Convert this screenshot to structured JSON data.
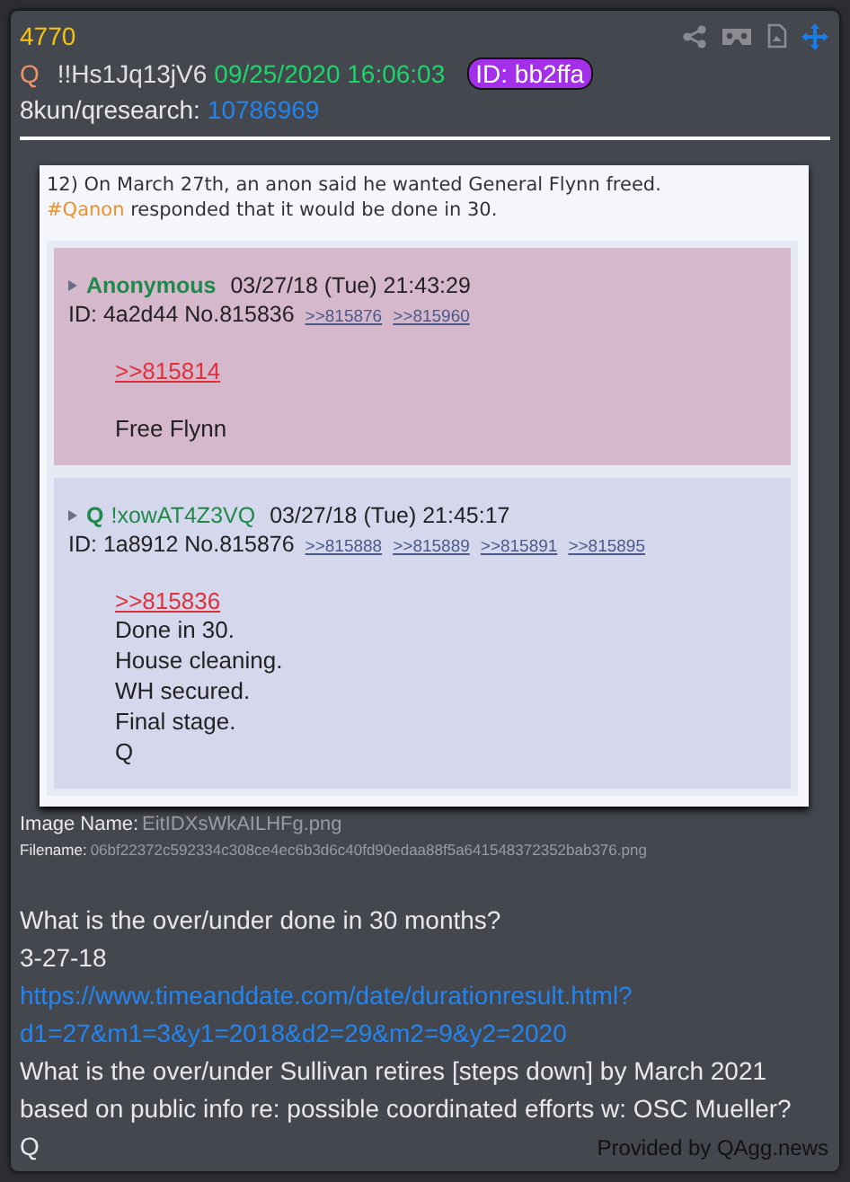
{
  "post": {
    "number": "4770",
    "author": "Q",
    "tripcode": "!!Hs1Jq13jV6",
    "timestamp": "09/25/2020 16:06:03",
    "id_badge": "ID: bb2ffa",
    "board": "8kun/qresearch:",
    "thread": "10786969"
  },
  "image": {
    "caption": "12) On March 27th, an anon said he wanted General Flynn freed.",
    "hashtag": "#Qanon",
    "caption_rest": "responded that it would be done in 30.",
    "posts": [
      {
        "name": "Anonymous",
        "date": "03/27/18 (Tue) 21:43:29",
        "id_line": "ID: 4a2d44 No.815836",
        "replies": [
          ">>815876",
          ">>815960"
        ],
        "quote": ">>815814",
        "kind": "spaced",
        "lines": [
          "Free Flynn"
        ],
        "color": "#d6b8cd"
      },
      {
        "name": "Q",
        "trip": "!xowAT4Z3VQ",
        "date": "03/27/18 (Tue) 21:45:17",
        "id_line": "ID: 1a8912 No.815876",
        "replies": [
          ">>815888",
          ">>815889",
          ">>815891",
          ">>815895"
        ],
        "quote": ">>815836",
        "kind": "compact",
        "lines": [
          "Done in 30.",
          "House cleaning.",
          "WH secured.",
          "Final stage.",
          "Q"
        ],
        "color": "#d5d8ec"
      }
    ]
  },
  "image_name": {
    "label": "Image Name:",
    "value": "EitIDXsWkAILHFg.png"
  },
  "filename": {
    "label": "Filename:",
    "value": "06bf22372c592334c308ce4ec6b3d6c40fd90edaa88f5a641548372352bab376.png"
  },
  "body": [
    {
      "kind": "text",
      "text": "What is the over/under done in 30 months?"
    },
    {
      "kind": "text",
      "text": "3-27-18"
    },
    {
      "kind": "link",
      "text": "https://www.timeanddate.com/date/durationresult.html?"
    },
    {
      "kind": "link",
      "text": "d1=27&m1=3&y1=2018&d2=29&m2=9&y2=2020"
    },
    {
      "kind": "text",
      "text": "What is the over/under Sullivan retires [steps down] by March 2021 based on public info re: possible coordinated efforts w: OSC Mueller?"
    },
    {
      "kind": "text",
      "text": "Q"
    }
  ],
  "footer": "Provided by QAgg.news"
}
